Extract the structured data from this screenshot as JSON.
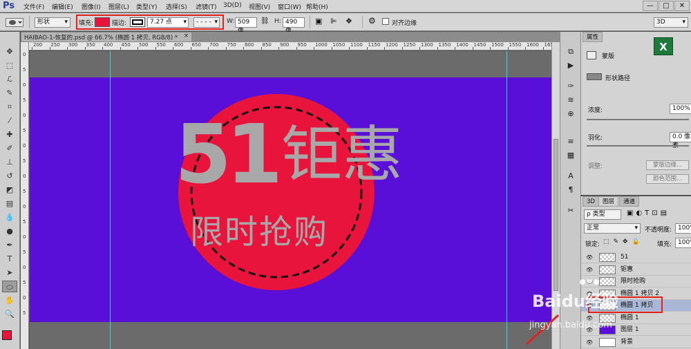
{
  "app": {
    "logo": "Ps"
  },
  "menu": [
    "文件(F)",
    "编辑(E)",
    "图像(I)",
    "图层(L)",
    "类型(Y)",
    "选择(S)",
    "滤镜(T)",
    "3D(D)",
    "视图(V)",
    "窗口(W)",
    "帮助(H)"
  ],
  "window_controls": {
    "minimize": "—",
    "restore": "□",
    "close": "✕"
  },
  "options": {
    "mode_value": "形状",
    "fill_label": "填充:",
    "fill_color": "#e8143c",
    "stroke_label": "描边:",
    "stroke_width": "7.27 点",
    "dash_style": "- - - -",
    "w_label": "W:",
    "w_value": "509 像",
    "h_label": "H:",
    "h_value": "490 像",
    "align_edges_label": "对齐边缘",
    "workspace": "3D"
  },
  "document": {
    "tab_title": "HAIBAO-1-恢复的.psd @ 66.7% (椭圆 1 拷贝, RGB/8) *",
    "tab_close": "×",
    "ruler_top": [
      "200",
      "250",
      "300",
      "350",
      "400",
      "450",
      "500",
      "550",
      "600",
      "650",
      "700",
      "750",
      "800",
      "850",
      "900",
      "950",
      "1000",
      "1050",
      "1100",
      "1150",
      "1200",
      "1250",
      "1300",
      "1350",
      "1400",
      "1450",
      "1500",
      "1550",
      "1600",
      "1650"
    ],
    "ruler_left": [
      "0",
      "5",
      "0",
      "5",
      "0",
      "5",
      "0",
      "5",
      "0",
      "5",
      "0",
      "5",
      "0",
      "5",
      "0",
      "5",
      "0",
      "5"
    ],
    "canvas_bg": "#5a0fd8",
    "circle_color": "#e8143c",
    "text_color": "#a8a8a8",
    "headline_number": "51",
    "headline_text": "钜惠",
    "subline_text": "限时抢购"
  },
  "properties": {
    "tab": "属性",
    "mask_label": "蒙版",
    "shape_path_label": "形状路径",
    "density_label": "浓度:",
    "density_value": "100%",
    "feather_label": "羽化:",
    "feather_value": "0.0 像素",
    "adjust_label": "调整:",
    "mask_edge_button": "蒙版边缘...",
    "color_range_button": "颜色范围...",
    "excel_badge": "X"
  },
  "layers_panel": {
    "tabs": [
      "3D",
      "图层",
      "通道"
    ],
    "kind_filter": "ρ 类型",
    "blend_mode": "正常",
    "opacity_label": "不透明度:",
    "opacity_value": "100%",
    "lock_label": "锁定:",
    "fill_label": "填充:",
    "fill_value": "100%",
    "layers": [
      {
        "name": "51"
      },
      {
        "name": "钜惠"
      },
      {
        "name": "限时抢购"
      },
      {
        "name": "椭圆 1 拷贝 2"
      },
      {
        "name": "椭圆 1 拷贝"
      },
      {
        "name": "椭圆 1"
      },
      {
        "name": "图层 1"
      },
      {
        "name": "背景"
      }
    ]
  },
  "colors": {
    "foreground": "#e8143c",
    "background": "#5a0fd8",
    "highlight": "#e2221e"
  },
  "watermark": {
    "brand": "Baidu经验",
    "url": "jingyan.baidu.com"
  }
}
